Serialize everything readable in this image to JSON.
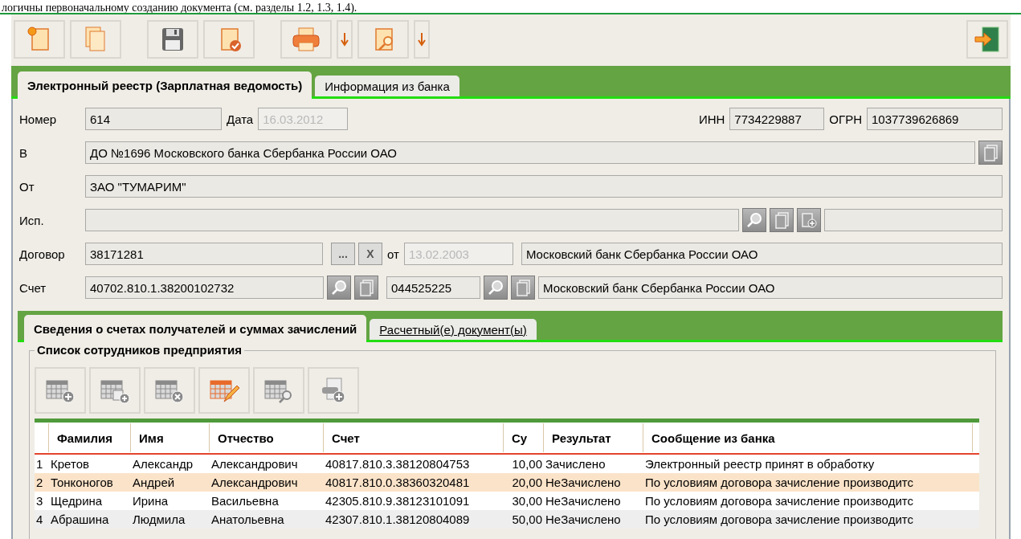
{
  "document_text": "логичны первоначальному созданию документа (см. разделы 1.2, 1.3, 1.4).",
  "tabs": [
    {
      "label": "Электронный реестр (Зарплатная ведомость)",
      "selected": true
    },
    {
      "label": "Информация из банка",
      "selected": false
    }
  ],
  "form": {
    "number": {
      "label": "Номер",
      "value": "614"
    },
    "date": {
      "label": "Дата",
      "value": "16.03.2012",
      "disabled": true
    },
    "inn": {
      "label": "ИНН",
      "value": "7734229887"
    },
    "ogrn": {
      "label": "ОГРН",
      "value": "1037739626869"
    },
    "recipient": {
      "label": "В",
      "value": "ДО №1696 Московского банка Сбербанка России ОАО"
    },
    "sender": {
      "label": "От",
      "value": "ЗАО \"ТУМАРИМ\""
    },
    "executor": {
      "label": "Исп."
    },
    "contract": {
      "label": "Договор",
      "value": "38171281",
      "browse": "...",
      "clear": "X",
      "date_label": "от",
      "date": "13.02.2003",
      "date_disabled": true,
      "bank": "Московский банк Сбербанка России ОАО"
    },
    "account": {
      "label": "Счет",
      "value": "40702.810.1.38200102732",
      "bik": "044525225",
      "bank": "Московский банк Сбербанка России ОАО"
    }
  },
  "sub_tabs": [
    {
      "label": "Сведения о счетах получателей и суммах зачислений",
      "selected": true
    },
    {
      "label": "Расчетный(е) документ(ы)",
      "selected": false
    }
  ],
  "group_title": "Список сотрудников предприятия",
  "table": {
    "columns": [
      "",
      "Фамилия",
      "Имя",
      "Отчество",
      "Счет",
      "Су",
      "Результат",
      "Сообщение из банка"
    ],
    "rows": [
      {
        "cells": [
          "1",
          "Кретов",
          "Александр",
          "Александрович",
          "40817.810.3.38120804753",
          "10,00",
          "Зачислено",
          "Электронный реестр принят в обработку"
        ],
        "selected": false
      },
      {
        "cells": [
          "2",
          "Тонконогов",
          "Андрей",
          "Александрович",
          "40817.810.0.38360320481",
          "20,00",
          "НеЗачислено",
          "По условиям договора зачисление производитс"
        ],
        "selected": true
      },
      {
        "cells": [
          "3",
          "Щедрина",
          "Ирина",
          "Васильевна",
          "42305.810.9.38123101091",
          "30,00",
          "НеЗачислено",
          "По условиям договора зачисление производитс"
        ],
        "selected": false
      },
      {
        "cells": [
          "4",
          "Абрашина",
          "Людмила",
          "Анатольевна",
          "42307.810.1.38120804089",
          "50,00",
          "НеЗачислено",
          "По условиям договора зачисление производитс"
        ],
        "selected": false
      }
    ]
  }
}
